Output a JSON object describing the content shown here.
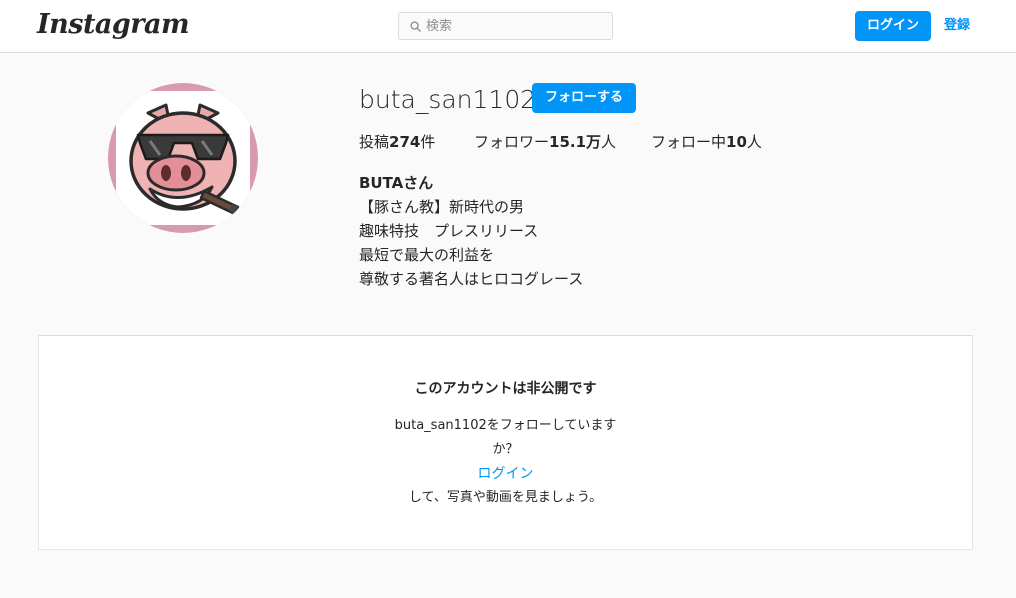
{
  "header": {
    "logo": "Instagram",
    "search_placeholder": "検索",
    "login_label": "ログイン",
    "register_label": "登録"
  },
  "profile": {
    "username": "buta_san1102",
    "follow_label": "フォローする",
    "stats": {
      "posts_prefix": "投稿",
      "posts_count": "274",
      "posts_suffix": "件",
      "followers_prefix": "フォロワー",
      "followers_count": "15.1万",
      "followers_suffix": "人",
      "following_prefix": "フォロー中",
      "following_count": "10",
      "following_suffix": "人"
    },
    "display_name": "BUTAさん",
    "bio": [
      "【豚さん教】新時代の男",
      "趣味特技　プレスリリース",
      "最短で最大の利益を",
      "尊敬する著名人はヒロコグレース"
    ]
  },
  "private_notice": {
    "title": "このアカウントは非公開です",
    "line1": "buta_san1102をフォローしています",
    "line2": "か？",
    "login_link": "ログイン",
    "line3": "して、写真や動画を見ましょう。"
  },
  "icons": {
    "search": "search-icon",
    "avatar": "pig-with-sunglasses-cigar-avatar"
  },
  "colors": {
    "accent": "#0095f6",
    "background": "#fafafa",
    "border": "#dbdbdb",
    "text": "#262626"
  }
}
